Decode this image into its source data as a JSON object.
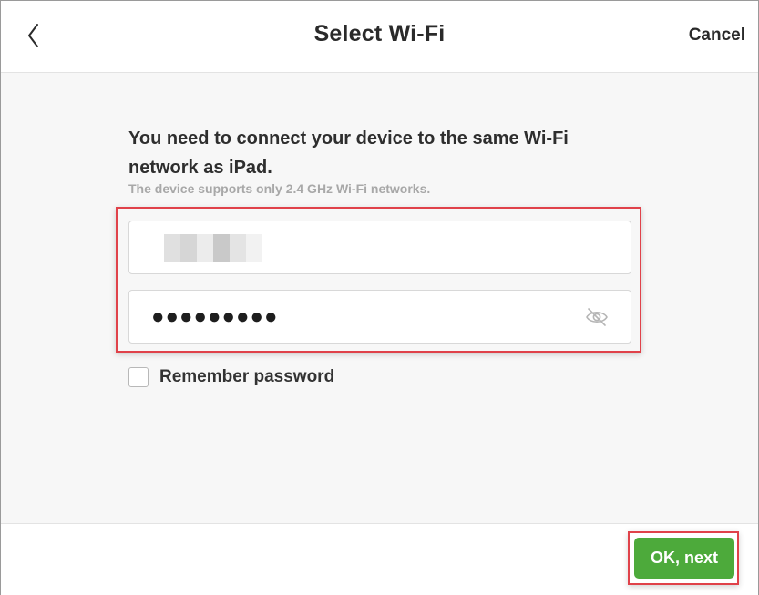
{
  "header": {
    "title": "Select Wi-Fi",
    "cancel_label": "Cancel",
    "back_icon": "chevron-left-icon"
  },
  "main": {
    "heading": "You need to connect your device to the same Wi-Fi network as iPad.",
    "subtext": "The device supports only 2.4 GHz Wi-Fi networks.",
    "ssid_field": {
      "value_state": "pixelated/redacted"
    },
    "password_field": {
      "value": "●●●●●●●●●",
      "visibility_icon": "eye-off-icon"
    },
    "remember": {
      "label": "Remember password",
      "checked": false
    },
    "highlight_color": "#e0424a"
  },
  "footer": {
    "ok_label": "OK, next",
    "ok_color": "#4daa3b"
  }
}
